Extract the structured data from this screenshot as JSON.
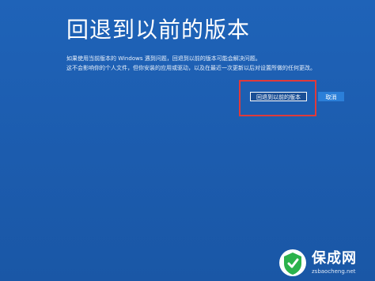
{
  "dialog": {
    "title": "回退到以前的版本",
    "description_line1": "如果使用当前版本的 Windows 遇到问题，回退到以前的版本可能会解决问题。",
    "description_line2": "这不会影响你的个人文件，但你安装的应用或驱动，以及在最近一次更新以后对设置所做的任何更改。"
  },
  "buttons": {
    "rollback_label": "回退到以前的版本",
    "cancel_label": "取消"
  },
  "watermark": {
    "name": "保成网",
    "url": "zsbaocheng.net"
  },
  "colors": {
    "background": "#1c5cae",
    "highlight": "#e03a3a",
    "cancel_button": "#2b7fd9",
    "watermark_logo": "#2bb24c"
  }
}
